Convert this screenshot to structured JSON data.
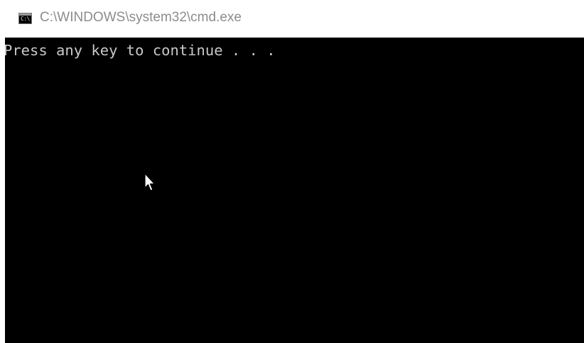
{
  "window": {
    "title": "C:\\WINDOWS\\system32\\cmd.exe",
    "icon": "cmd-icon",
    "icon_text": "C:\\."
  },
  "console": {
    "lines": [
      "Press any key to continue . . ."
    ],
    "background_color": "#000000",
    "text_color": "#c0c0c0"
  },
  "cursor": {
    "icon": "mouse-pointer-arrow-icon"
  }
}
